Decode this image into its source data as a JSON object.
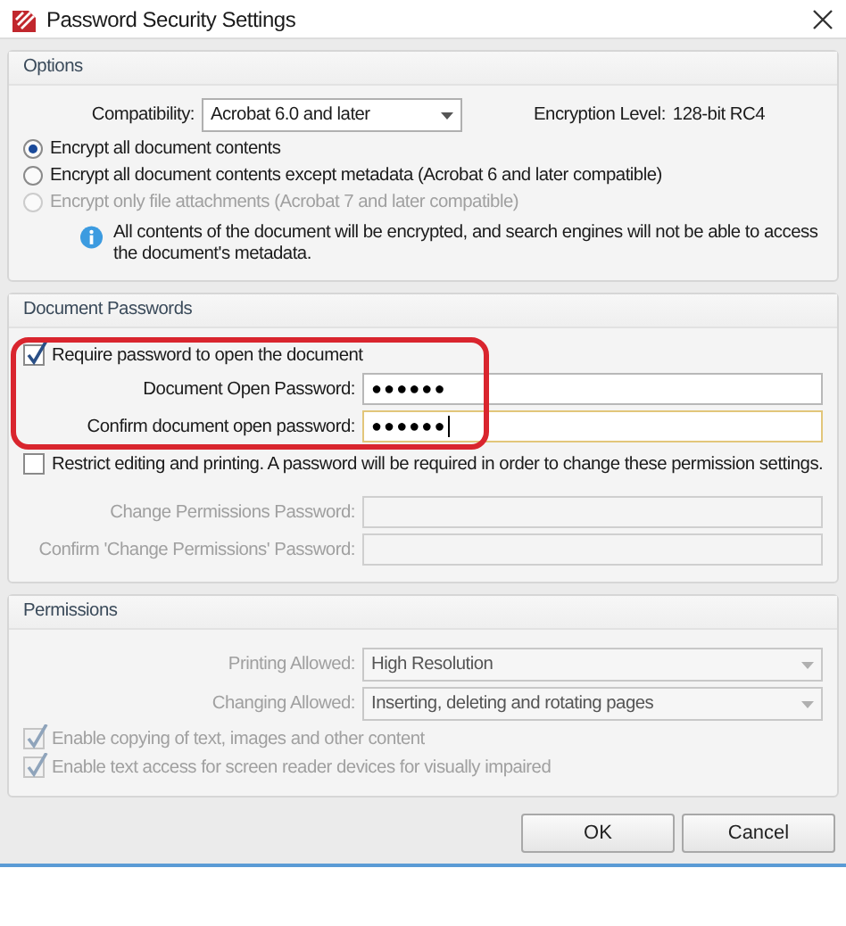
{
  "window": {
    "title": "Password Security Settings"
  },
  "options": {
    "title": "Options",
    "compatibility": {
      "label": "Compatibility:",
      "value": "Acrobat 6.0 and later"
    },
    "encryption_level": {
      "label": "Encryption Level:",
      "value": "128-bit RC4"
    },
    "radios": [
      {
        "label": "Encrypt all document contents",
        "selected": true,
        "disabled": false
      },
      {
        "label": "Encrypt all document contents except metadata (Acrobat 6 and later compatible)",
        "selected": false,
        "disabled": false
      },
      {
        "label": "Encrypt only file attachments (Acrobat 7 and later compatible)",
        "selected": false,
        "disabled": true
      }
    ],
    "info": "All contents of the document will be encrypted, and search engines will not be able to access the document's metadata."
  },
  "document_passwords": {
    "title": "Document Passwords",
    "highlighted": true,
    "require_open": {
      "label": "Require password to open the document",
      "checked": true,
      "disabled": false
    },
    "open_fields": [
      {
        "label": "Document Open Password:",
        "value": "●●●●●●",
        "disabled": false,
        "focused": false
      },
      {
        "label": "Confirm document open password:",
        "value": "●●●●●●",
        "disabled": false,
        "focused": true
      }
    ],
    "restrict": {
      "label": "Restrict editing and printing. A password will be required in order to change these permission settings.",
      "checked": false,
      "disabled": false
    },
    "permission_fields": [
      {
        "label": "Change Permissions Password:",
        "disabled": true,
        "focused": false
      },
      {
        "label": "Confirm 'Change Permissions' Password:",
        "disabled": true,
        "focused": false
      }
    ]
  },
  "permissions": {
    "title": "Permissions",
    "dropdowns": [
      {
        "label": "Printing Allowed:",
        "value": "High Resolution",
        "disabled": true
      },
      {
        "label": "Changing Allowed:",
        "value": "Inserting, deleting and rotating pages",
        "disabled": true
      }
    ],
    "checks": [
      {
        "label": "Enable copying of text, images and other content",
        "checked": true,
        "disabled": true
      },
      {
        "label": "Enable text access for screen reader devices for visually impaired",
        "checked": true,
        "disabled": true
      }
    ]
  },
  "buttons": [
    {
      "label": "OK"
    },
    {
      "label": "Cancel"
    }
  ]
}
